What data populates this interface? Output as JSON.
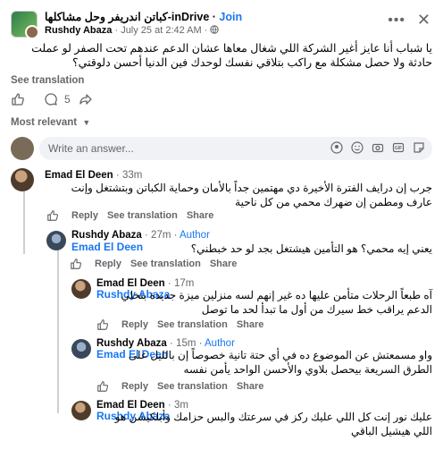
{
  "post": {
    "group_name": "كباتن اندريفر وحل مشاكلها-inDrive",
    "join_label": "Join",
    "author": "Rushdy Abaza",
    "date": "July 25 at 2:42 AM",
    "separator": "·",
    "text": "يا شباب أنا عايز أغير الشركة اللي شغال معاها عشان الدعم عندهم تحت الصفر لو عملت حادثة ولا حصل مشكلة مع راكب بتلاقي نفسك لوحدك فين الدنيا أحسن دلوقتي؟",
    "see_translation": "See translation",
    "comment_count": "5"
  },
  "sort_label": "Most relevant",
  "composer": {
    "placeholder": "Write an answer..."
  },
  "labels": {
    "reply": "Reply",
    "see_translation": "See translation",
    "share": "Share",
    "author_badge": "Author"
  },
  "comments": [
    {
      "name": "Emad El Deen",
      "time": "33m",
      "text": "جرب إن درايف الفترة الأخيرة دي مهتمين جداً بالأمان وحماية الكباتن وبتشتغل وإنت عارف ومطمن إن ضهرك محمي من كل ناحية"
    },
    {
      "name": "Rushdy Abaza",
      "time": "27m",
      "mention": "Emad El Deen",
      "text": "يعني إيه محمي؟ هو التأمين هيشتغل بجد لو حد خبطني؟"
    },
    {
      "name": "Emad El Deen",
      "time": "17m",
      "mention": "Rushdy Abaza",
      "text": "آه طبعاً الرحلات متأمن عليها ده غير إنهم لسه منزلين ميزة جديدة بتخلي الدعم يراقب خط سيرك من أول ما تبدأ لحد ما توصل"
    },
    {
      "name": "Rushdy Abaza",
      "time": "15m",
      "mention": "Emad El Deen",
      "text": "واو مسمعتش عن الموضوع ده في أي حتة تانية خصوصاً إن بالليل على الطرق السريعة بيحصل بلاوي والأحسن الواحد يأمن نفسه"
    },
    {
      "name": "Emad El Deen",
      "time": "3m",
      "mention": "Rushdy Abaza",
      "text": "عليك نور إنت كل اللي عليك ركز في سرعتك والبس حزامك وأبلكيشن هو اللي هيشيل الباقي"
    }
  ]
}
